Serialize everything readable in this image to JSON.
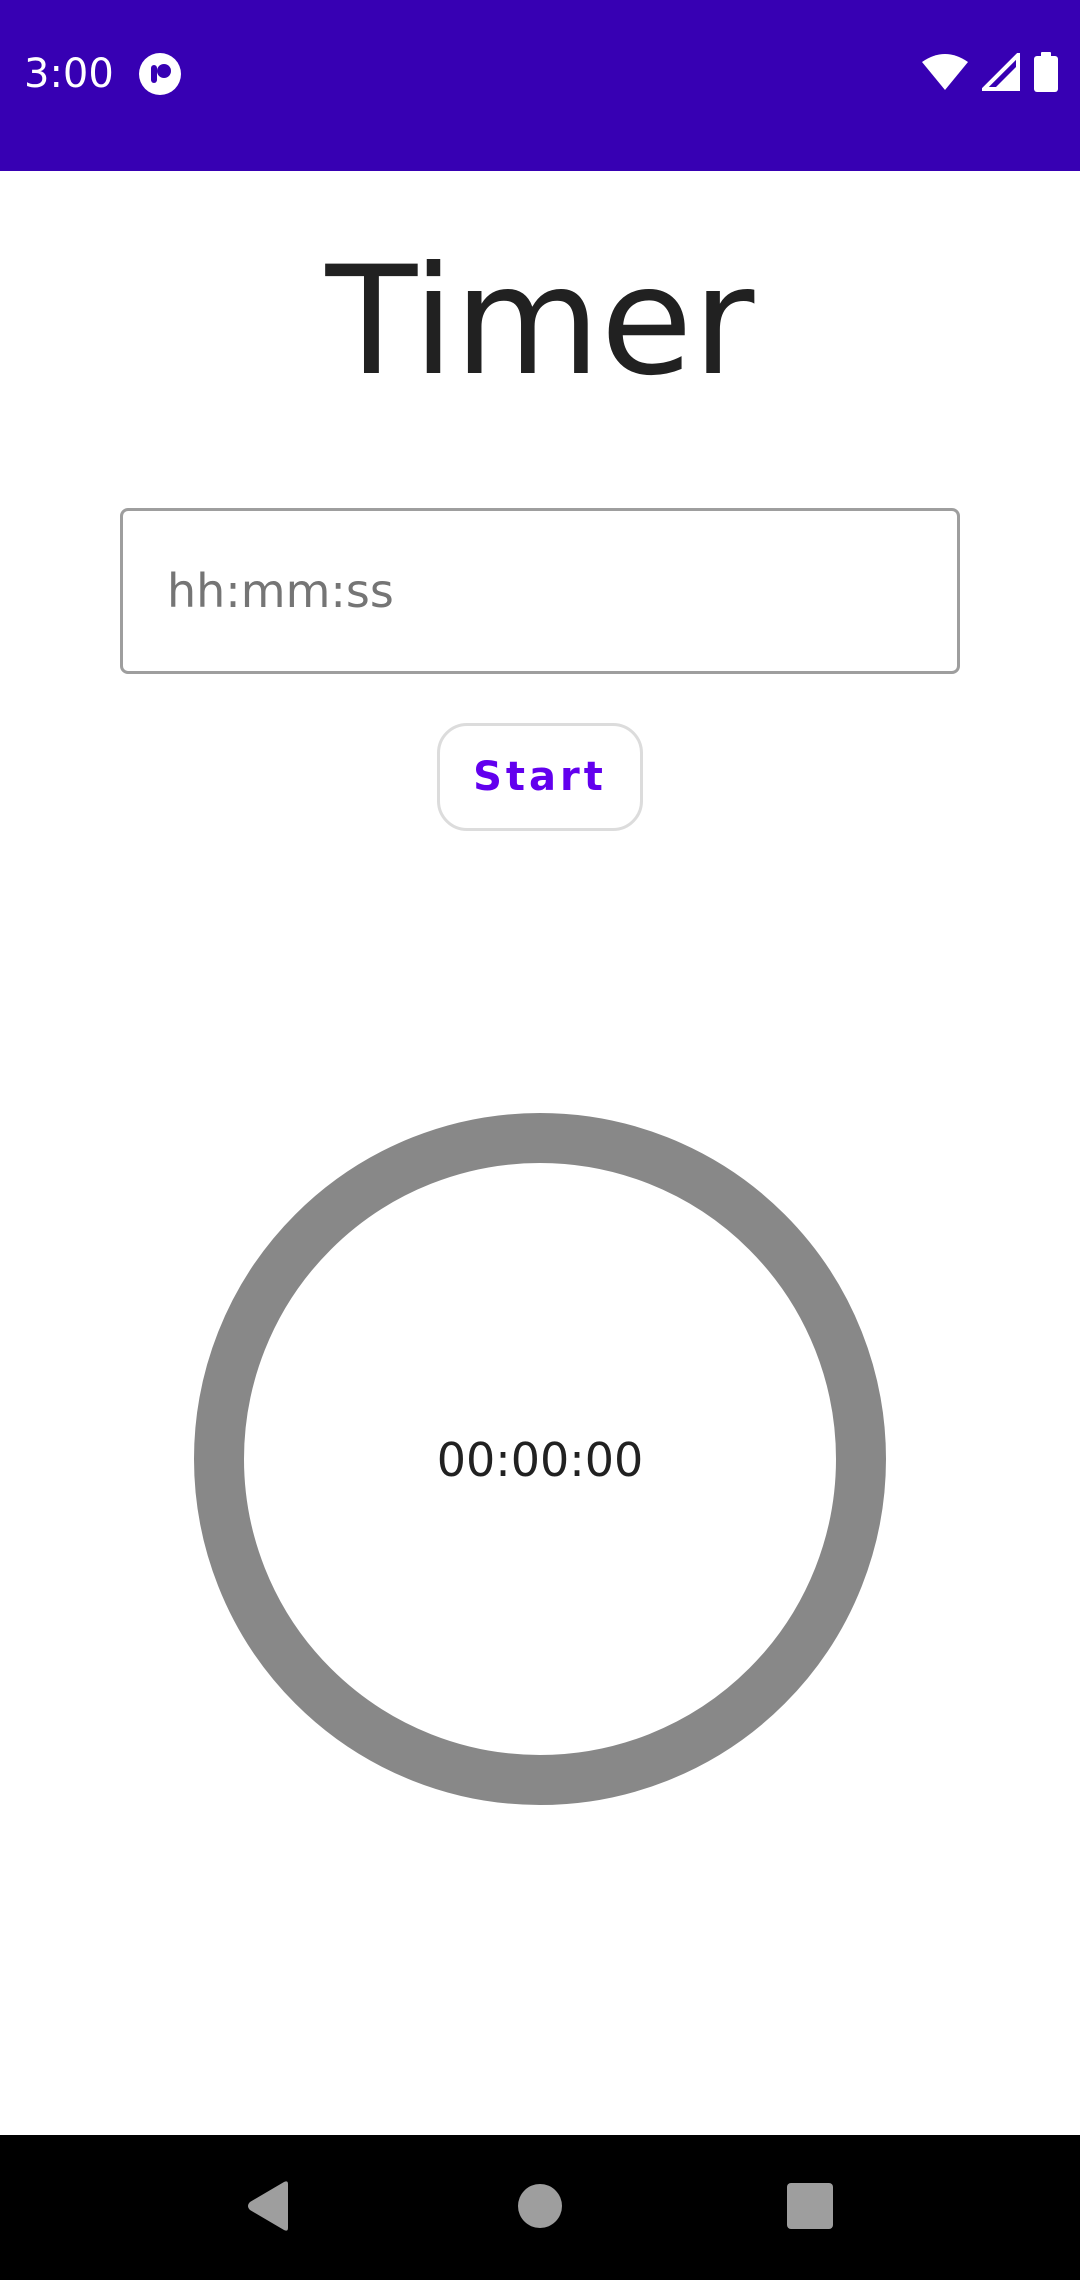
{
  "status_bar": {
    "time": "3:00",
    "app_icon": "notification-app-icon",
    "icons": [
      "wifi-icon",
      "cellular-signal-icon",
      "battery-icon"
    ],
    "background_color": "#3700b3"
  },
  "title": "Timer",
  "duration_input": {
    "value": "",
    "placeholder": "hh:mm:ss"
  },
  "start_button": {
    "label": "Start",
    "color": "#6200ee"
  },
  "timer": {
    "display": "00:00:00",
    "progress": 0,
    "ring_color": "#888888"
  },
  "nav_bar": {
    "buttons": [
      "back-icon",
      "home-icon",
      "recents-icon"
    ]
  }
}
